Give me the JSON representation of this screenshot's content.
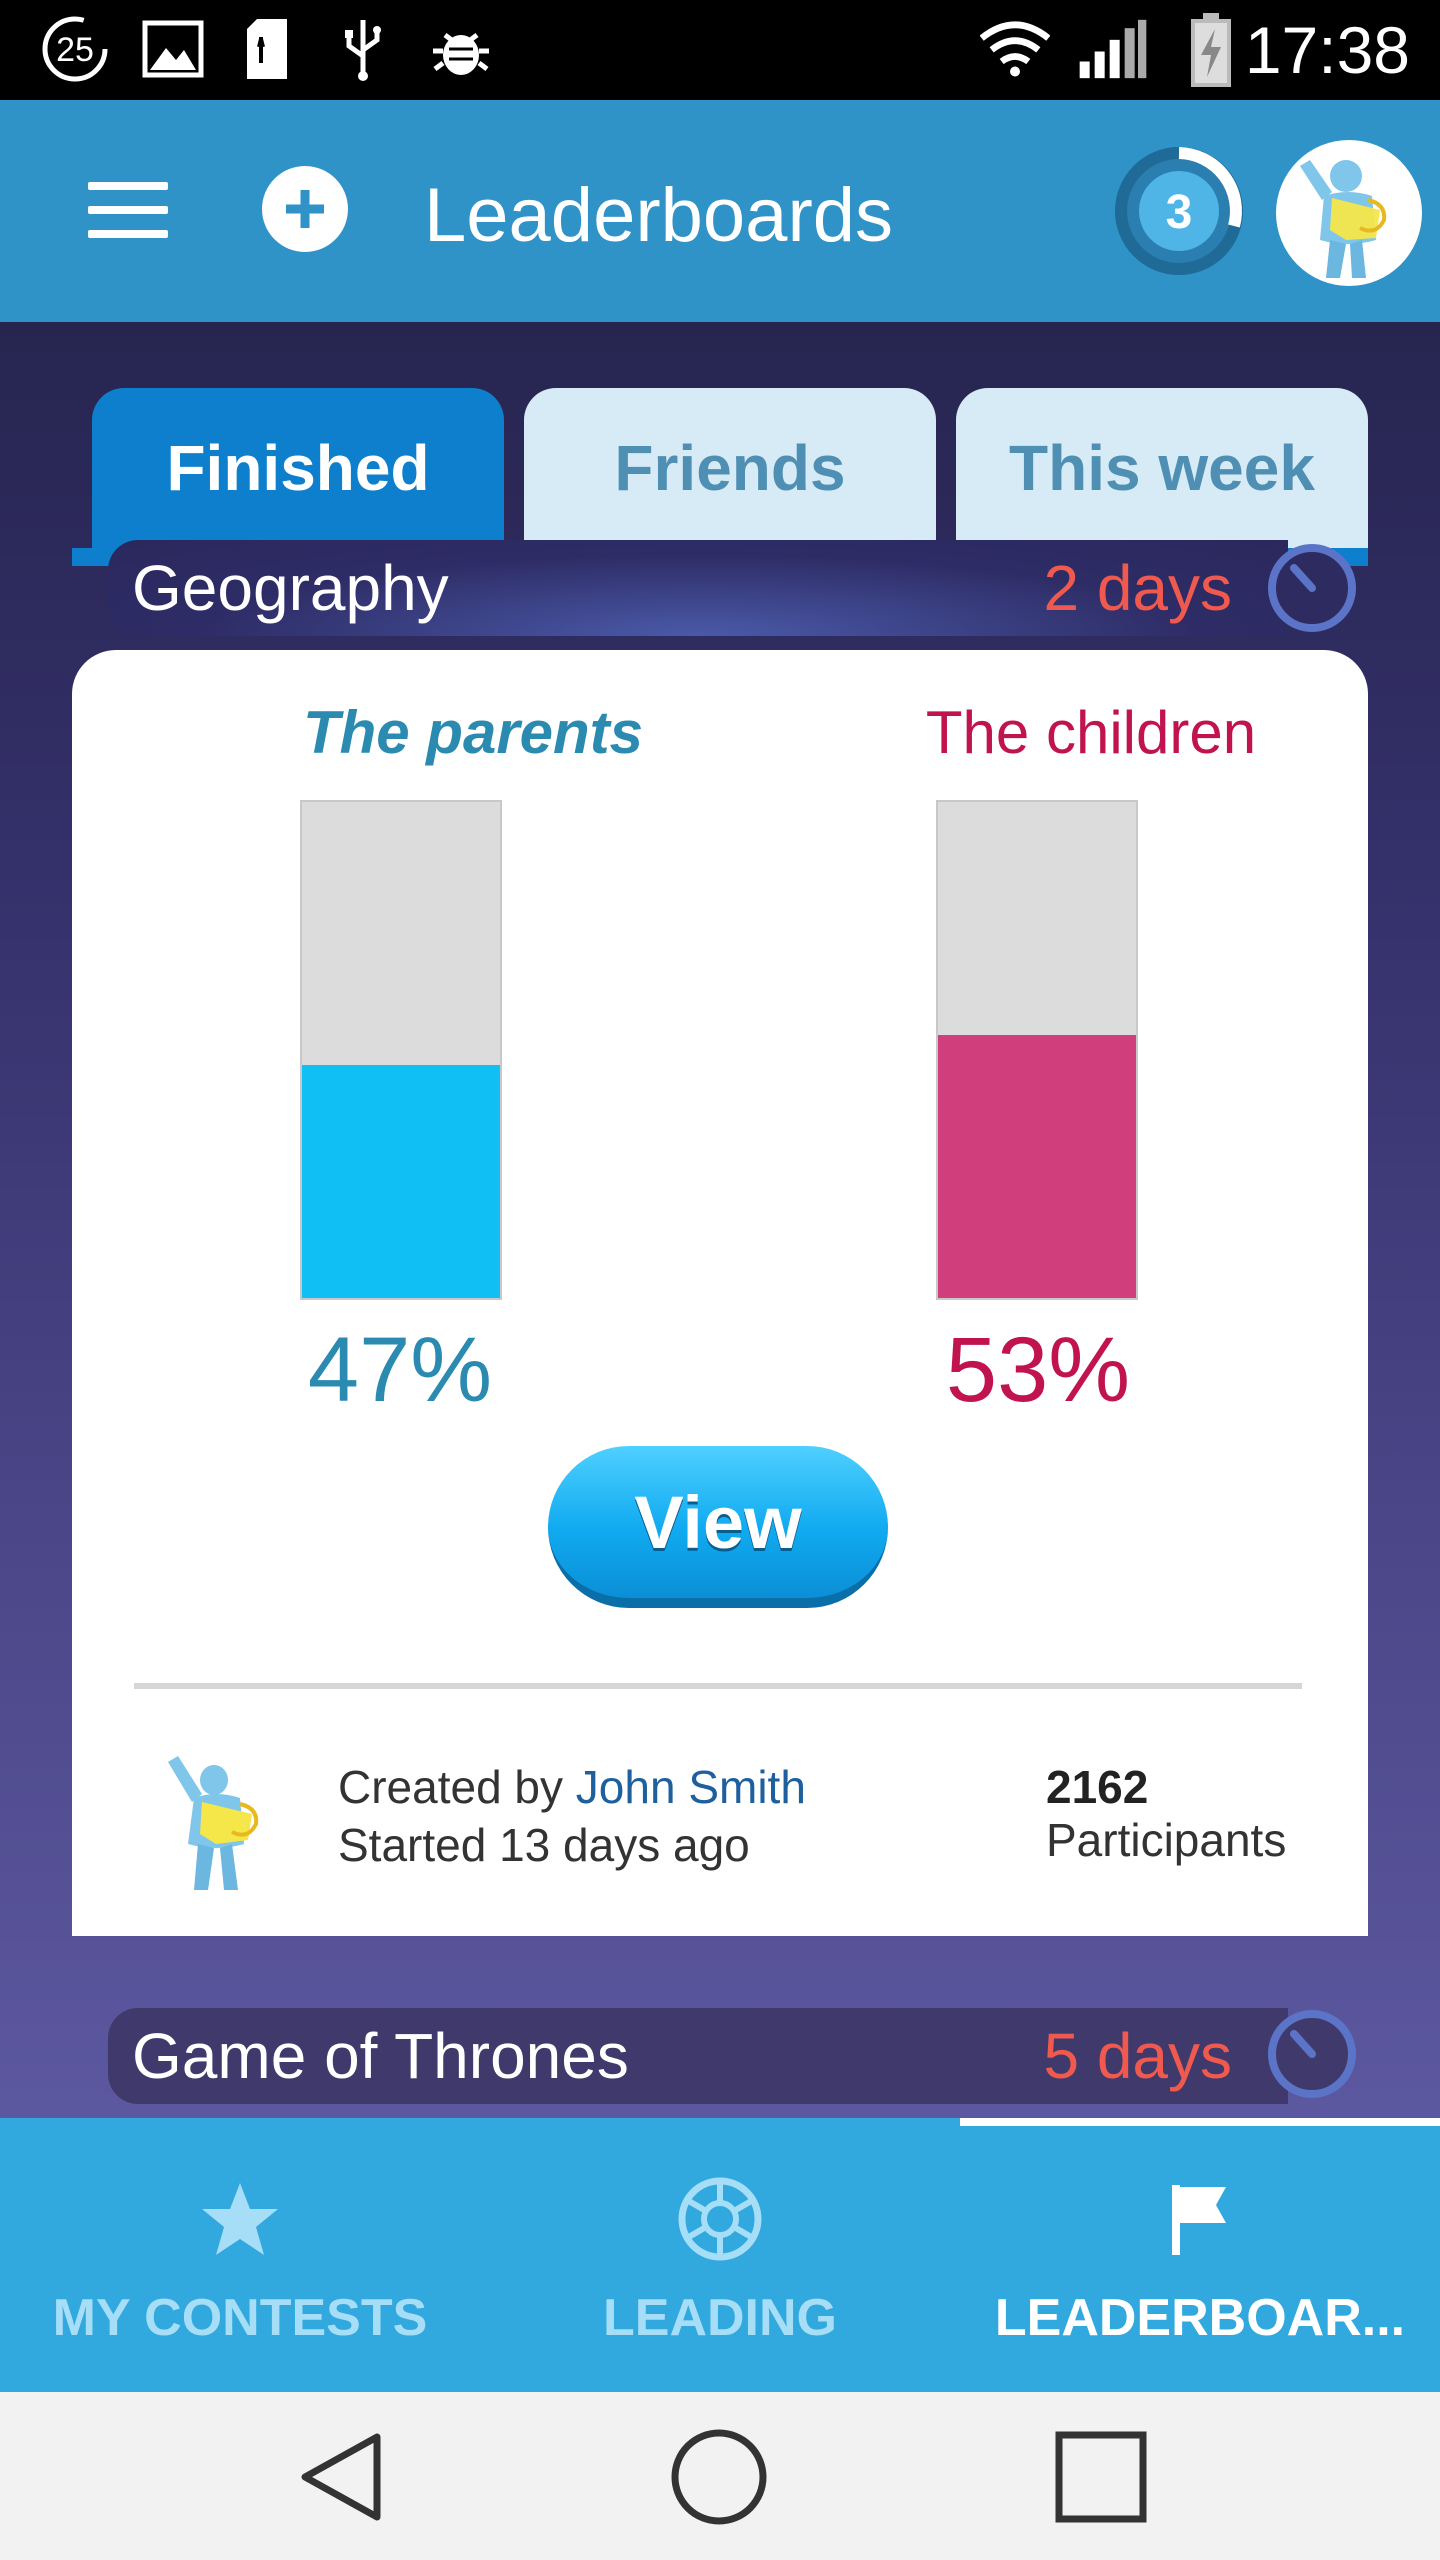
{
  "status_bar": {
    "notification_count": "25",
    "time": "17:38",
    "icons": [
      "notification-count-icon",
      "image-icon",
      "sd-card-icon",
      "usb-icon",
      "debug-icon",
      "wifi-icon",
      "signal-icon",
      "battery-charging-icon"
    ]
  },
  "app_bar": {
    "title": "Leaderboards",
    "level": "3",
    "icons": [
      "menu-icon",
      "add-icon",
      "level-progress-ring",
      "user-avatar"
    ]
  },
  "tabs": [
    {
      "label": "Finished",
      "active": true
    },
    {
      "label": "Friends",
      "active": false
    },
    {
      "label": "This week",
      "active": false
    }
  ],
  "contests": [
    {
      "name": "Geography",
      "time_left": "2 days",
      "team_a": {
        "name": "The parents",
        "percent_label": "47%",
        "percent": 47,
        "color": "#10c0f4"
      },
      "team_b": {
        "name": "The children",
        "percent_label": "53%",
        "percent": 53,
        "color": "#d03f7b"
      },
      "view_label": "View",
      "created_by_prefix": "Created by ",
      "creator": "John Smith",
      "started": "Started 13 days ago",
      "participants_count": "2162",
      "participants_label": "Participants"
    },
    {
      "name": "Game of Thrones",
      "time_left": "5 days"
    }
  ],
  "bottom_nav": [
    {
      "label": "MY CONTESTS",
      "icon": "star-icon",
      "active": false
    },
    {
      "label": "LEADING",
      "icon": "aperture-icon",
      "active": false
    },
    {
      "label": "LEADERBOAR...",
      "icon": "flag-icon",
      "active": true
    }
  ],
  "colors": {
    "app_bar": "#2f93c8",
    "tab_active": "#0d7fcc",
    "tab_inactive": "#d6ebf6",
    "parents": "#2a8ab0",
    "children": "#c0134f",
    "time_left": "#f05a4e",
    "bottom_nav": "#31a8de"
  }
}
